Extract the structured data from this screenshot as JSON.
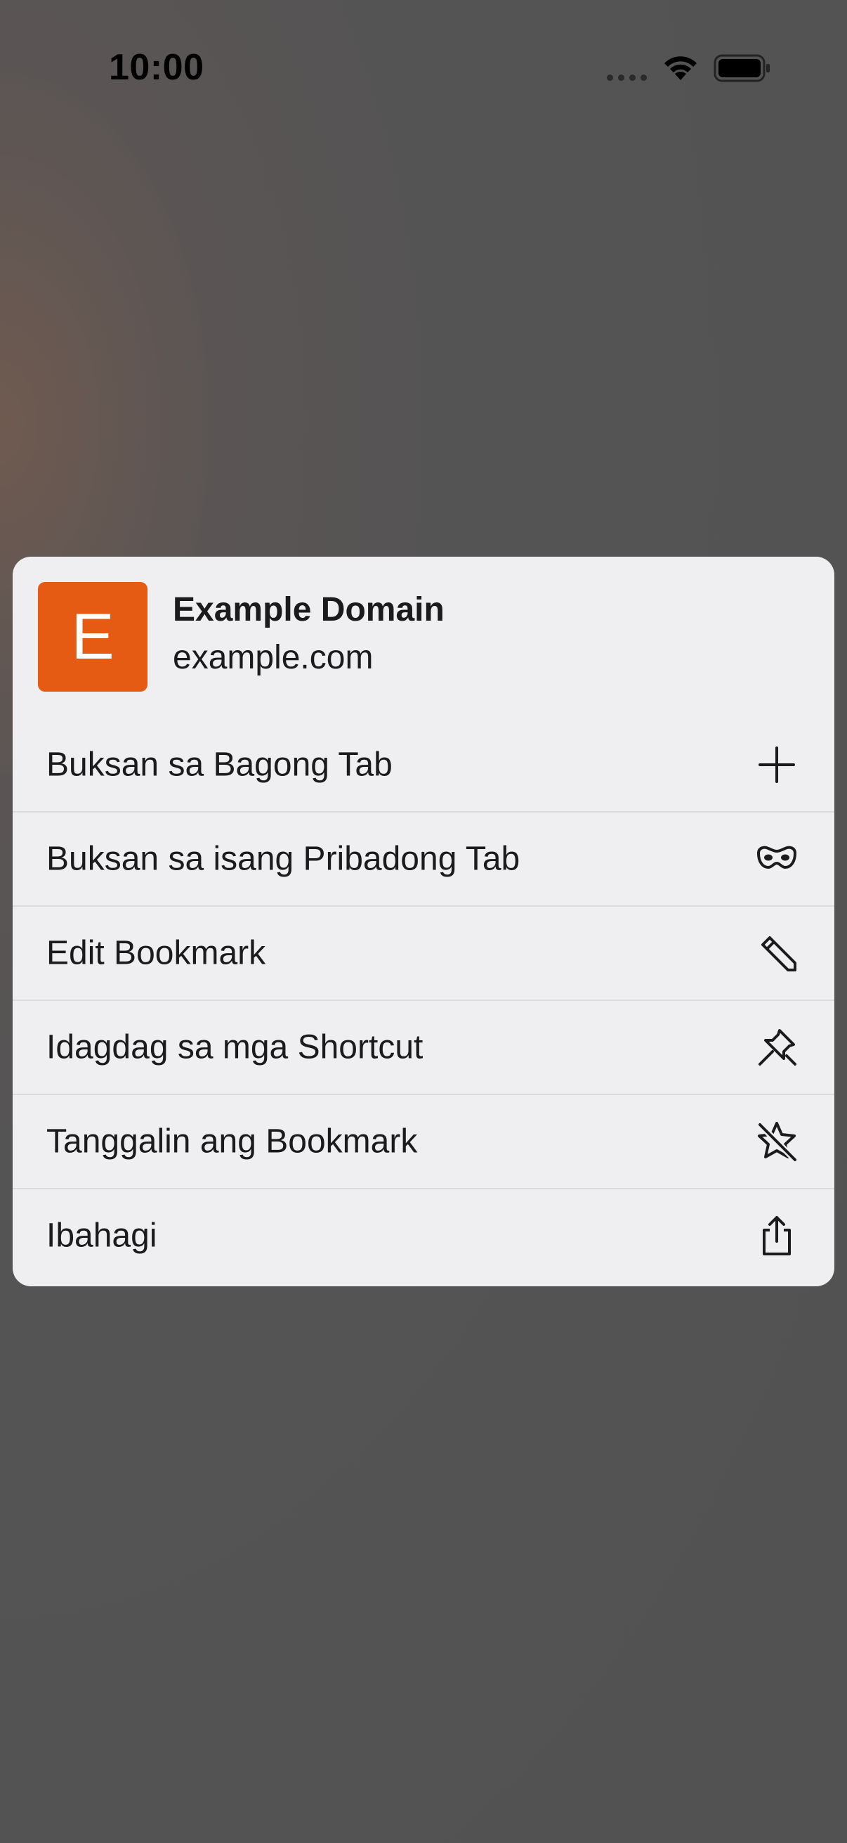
{
  "status_bar": {
    "time": "10:00"
  },
  "context_menu": {
    "favicon_letter": "E",
    "favicon_color": "#e55b13",
    "title": "Example Domain",
    "url": "example.com",
    "items": [
      {
        "label": "Buksan sa Bagong Tab",
        "icon": "plus-icon"
      },
      {
        "label": "Buksan sa isang Pribadong Tab",
        "icon": "private-mask-icon"
      },
      {
        "label": "Edit Bookmark",
        "icon": "pencil-icon"
      },
      {
        "label": "Idagdag sa mga Shortcut",
        "icon": "pin-icon"
      },
      {
        "label": "Tanggalin ang Bookmark",
        "icon": "star-slash-icon"
      },
      {
        "label": "Ibahagi",
        "icon": "share-icon"
      }
    ]
  }
}
